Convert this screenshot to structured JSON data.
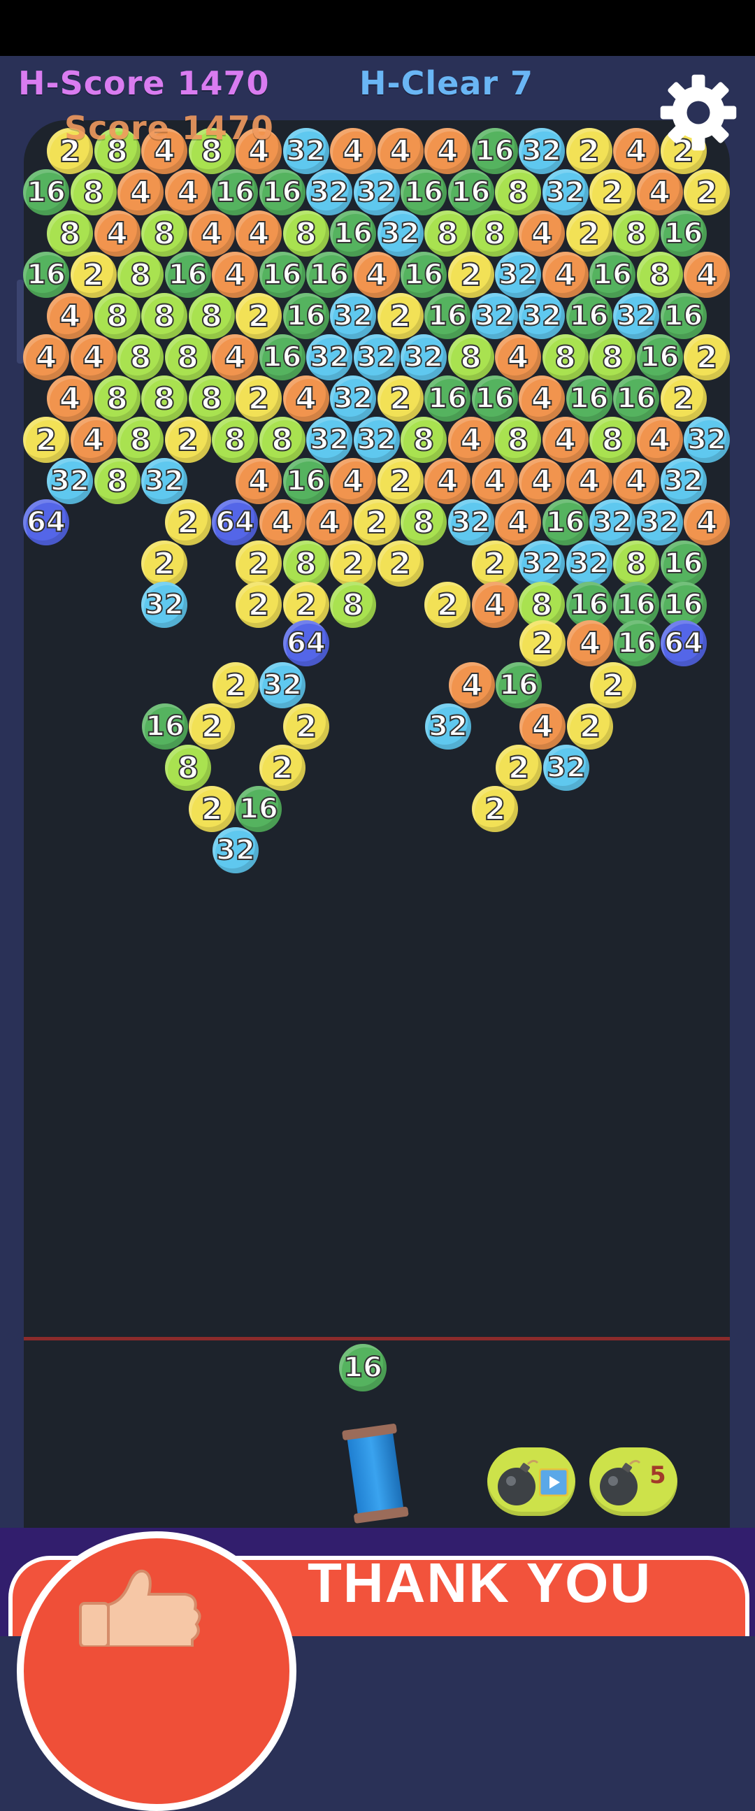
{
  "hud": {
    "high_score_label": "H-Score 1470",
    "high_clear_label": "H-Clear 7",
    "score_label": "Score 1470",
    "settings_icon": "gear-icon"
  },
  "colors": {
    "high_score": "#d97cf0",
    "high_clear": "#6ab6f5",
    "score": "#f09a5e",
    "board_bg": "#1d232c",
    "frame": "#2a3157",
    "bubble_2": "#f2e156",
    "bubble_4": "#f1944e",
    "bubble_8": "#a9e250",
    "bubble_16": "#55b35f",
    "bubble_32": "#5fc8ef",
    "bubble_64": "#5466e8"
  },
  "grid_rows": [
    [
      "2",
      "8",
      "4",
      "8",
      "4",
      "32",
      "4",
      "4",
      "4",
      "16",
      "32",
      "2",
      "4",
      "2"
    ],
    [
      "16",
      "8",
      "4",
      "4",
      "16",
      "16",
      "32",
      "32",
      "16",
      "16",
      "8",
      "32",
      "2",
      "4",
      "2"
    ],
    [
      "8",
      "4",
      "8",
      "4",
      "4",
      "8",
      "16",
      "32",
      "8",
      "8",
      "4",
      "2",
      "8",
      "16"
    ],
    [
      "16",
      "2",
      "8",
      "16",
      "4",
      "16",
      "16",
      "4",
      "16",
      "2",
      "32",
      "4",
      "16",
      "8",
      "4"
    ],
    [
      "4",
      "8",
      "8",
      "8",
      "2",
      "16",
      "32",
      "2",
      "16",
      "32",
      "32",
      "16",
      "32",
      "16"
    ],
    [
      "4",
      "4",
      "8",
      "8",
      "4",
      "16",
      "32",
      "32",
      "32",
      "8",
      "4",
      "8",
      "8",
      "16",
      "2"
    ],
    [
      "4",
      "8",
      "8",
      "8",
      "2",
      "4",
      "32",
      "2",
      "16",
      "16",
      "4",
      "16",
      "16",
      "2"
    ],
    [
      "2",
      "4",
      "8",
      "2",
      "8",
      "8",
      "32",
      "32",
      "8",
      "4",
      "8",
      "4",
      "8",
      "4",
      "32"
    ],
    [
      "32",
      "8",
      "32",
      "",
      "4",
      "16",
      "4",
      "2",
      "4",
      "4",
      "4",
      "4",
      "4",
      "32"
    ],
    [
      "64",
      "",
      "",
      "2",
      "64",
      "4",
      "4",
      "2",
      "8",
      "32",
      "4",
      "16",
      "32",
      "32",
      "4"
    ],
    [
      "",
      "",
      "2",
      "",
      "2",
      "8",
      "2",
      "2",
      "",
      "2",
      "32",
      "32",
      "8",
      "16"
    ],
    [
      "",
      "",
      "32",
      "",
      "2",
      "2",
      "8",
      "",
      "2",
      "4",
      "8",
      "16",
      "16",
      "16"
    ]
  ],
  "loose_bubbles": [
    {
      "value": "64"
    },
    {
      "value": "2"
    },
    {
      "value": "4"
    },
    {
      "value": "16"
    },
    {
      "value": "64"
    },
    {
      "value": "2"
    },
    {
      "value": "32"
    },
    {
      "value": "4"
    },
    {
      "value": "16"
    },
    {
      "value": "2"
    },
    {
      "value": "16"
    },
    {
      "value": "2"
    },
    {
      "value": "2"
    },
    {
      "value": "32"
    },
    {
      "value": "4"
    },
    {
      "value": "2"
    },
    {
      "value": "8"
    },
    {
      "value": "2"
    },
    {
      "value": "2"
    },
    {
      "value": "32"
    },
    {
      "value": "2"
    },
    {
      "value": "16"
    },
    {
      "value": "2"
    },
    {
      "value": "32"
    }
  ],
  "next_bubble": "16",
  "powerups": {
    "bomb_video": {
      "icon": "bomb-icon",
      "badge_icon": "video-icon"
    },
    "bomb_count": {
      "icon": "bomb-icon",
      "count": "5"
    }
  },
  "banner": {
    "text": "THANK YOU",
    "icon": "thumbs-up-icon"
  }
}
